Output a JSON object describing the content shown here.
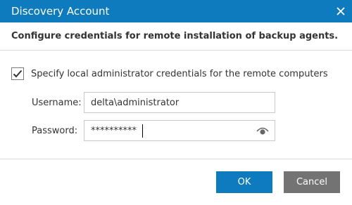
{
  "window": {
    "title": "Discovery Account",
    "close_icon": "close-icon",
    "accent_color": "#0f7bbf"
  },
  "header": {
    "heading": "Configure credentials for remote installation of backup agents."
  },
  "form": {
    "checkbox": {
      "label": "Specify local administrator credentials for the remote computers",
      "checked": true
    },
    "username": {
      "label": "Username:",
      "value": "delta\\administrator"
    },
    "password": {
      "label": "Password:",
      "value": "**********",
      "reveal_icon": "eye-icon"
    }
  },
  "footer": {
    "ok_label": "OK",
    "cancel_label": "Cancel",
    "ok_color": "#0f7bbf",
    "cancel_color": "#737373"
  }
}
